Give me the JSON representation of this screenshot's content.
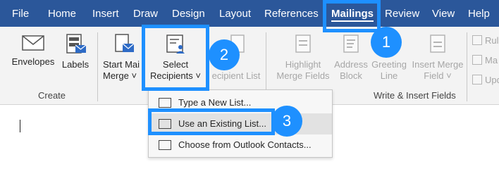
{
  "tabs": [
    {
      "label": "File"
    },
    {
      "label": "Home"
    },
    {
      "label": "Insert"
    },
    {
      "label": "Draw"
    },
    {
      "label": "Design"
    },
    {
      "label": "Layout"
    },
    {
      "label": "References"
    },
    {
      "label": "Mailings"
    },
    {
      "label": "Review"
    },
    {
      "label": "View"
    },
    {
      "label": "Help"
    }
  ],
  "create_group": {
    "label": "Create",
    "envelopes": "Envelopes",
    "labels": "Labels"
  },
  "start_group": {
    "start_line1": "Start Mai",
    "start_line2": "Merge",
    "select_line1": "Select",
    "select_line2": "Recipients",
    "edit_recipients": "ecipient List"
  },
  "write_group": {
    "label": "Write & Insert Fields",
    "highlight1": "Highlight",
    "highlight2": "Merge Fields",
    "address1": "Address",
    "address2": "Block",
    "greeting1": "Greeting",
    "greeting2": "Line",
    "insert1": "Insert Merge",
    "insert2": "Field",
    "rules": "Rul",
    "match": "Ma",
    "update": "Upd"
  },
  "menu": {
    "item1": "Type a New List...",
    "item2": "Use an Existing List...",
    "item3": "Choose from Outlook Contacts..."
  },
  "badges": {
    "b1": "1",
    "b2": "2",
    "b3": "3"
  },
  "colors": {
    "ribbon_tab_bar": "#2b579a",
    "highlight": "#1e90ff"
  }
}
